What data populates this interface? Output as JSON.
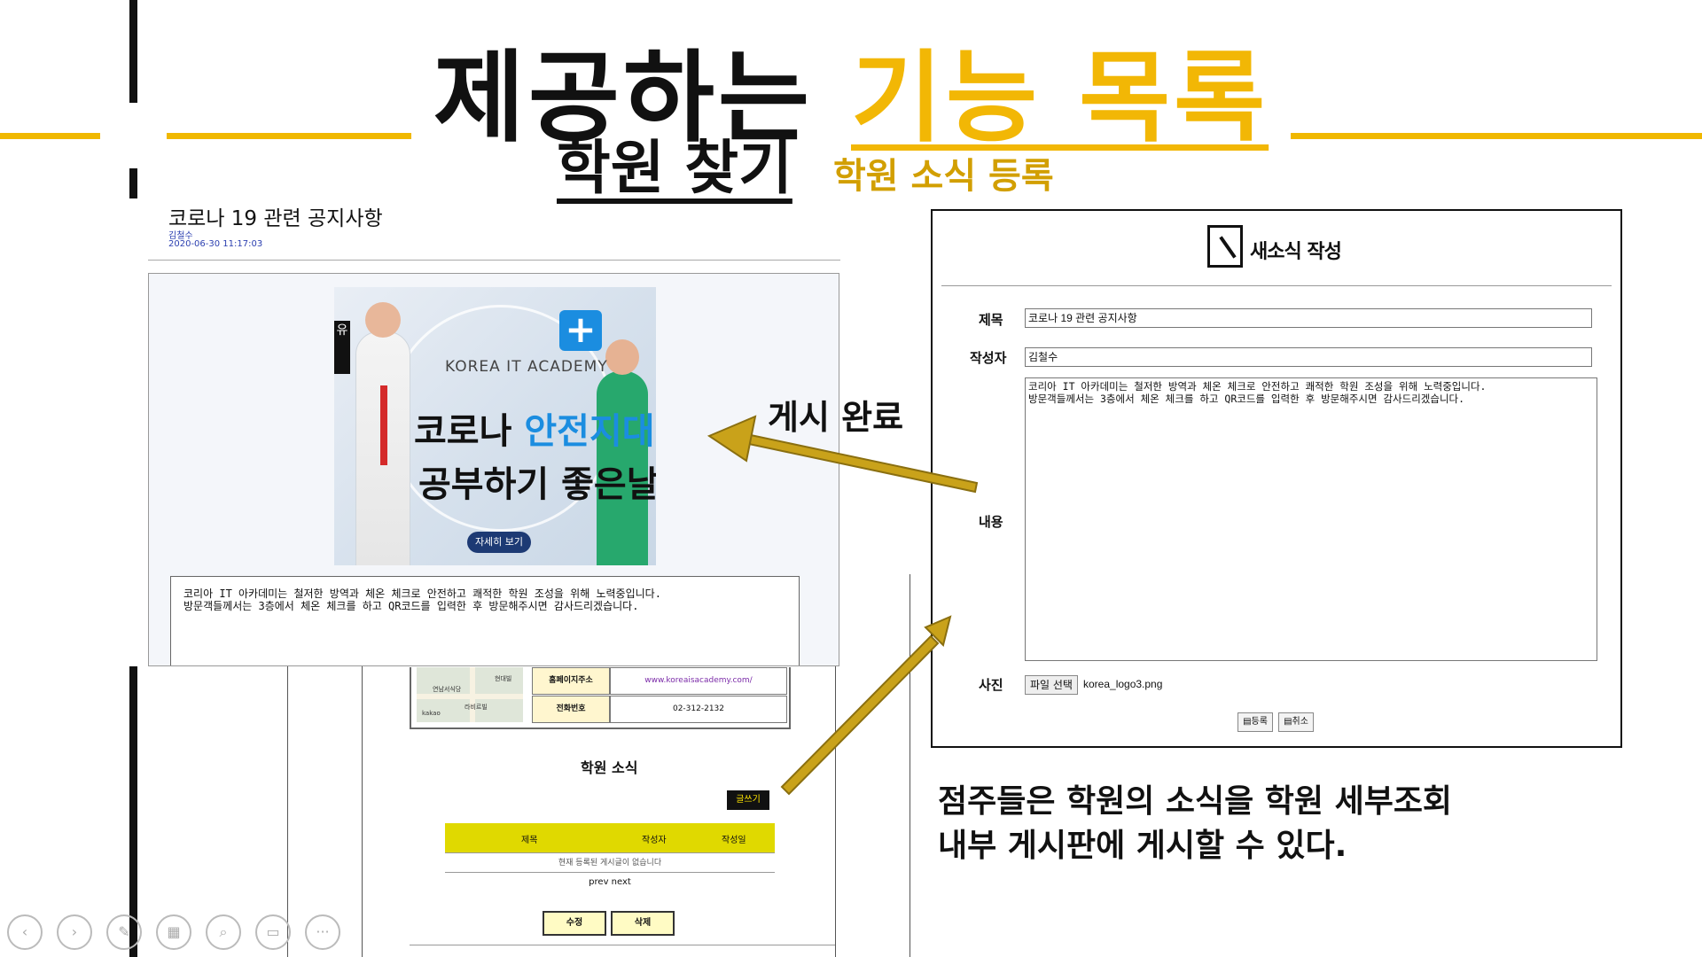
{
  "slide": {
    "title_main": "제공하는",
    "title_highlight": "기능 목록",
    "subtitle_main": "학원 찾기",
    "subtitle_secondary": "학원 소식 등록",
    "colors": {
      "accent": "#f2b705",
      "secondary_text": "#d29f00",
      "arrow": "#c9a21a"
    }
  },
  "post_view": {
    "title": "코로나 19 관련 공지사항",
    "author": "김철수",
    "date": "2020-06-30 11:17:03",
    "banner": {
      "academy": "KOREA IT ACADEMY",
      "line1_a": "코로나",
      "line1_b": "안전지대!",
      "line2": "공부하기 좋은날",
      "button": "자세히 보기"
    },
    "content_line1": "코리아 IT 아카데미는 철저한 방역과 체온 체크로 안전하고 쾌적한 학원 조성을 위해 노력중입니다.",
    "content_line2": "방문객들께서는 3층에서 체온 체크를 하고 QR코드를 입력한 후 방문해주시면 감사드리겠습니다."
  },
  "academy_detail": {
    "homepage_label": "홈페이지주소",
    "homepage_value": "www.koreaisacademy.com/",
    "phone_label": "전화번호",
    "phone_value": "02-312-2132",
    "map_brand": "kakao",
    "news_title": "학원 소식",
    "write_button": "글쓰기",
    "columns": [
      "제목",
      "작성자",
      "작성일"
    ],
    "empty_message": "현재 등록된 게시글이 없습니다",
    "pager": "prev next",
    "edit_button": "수정",
    "delete_button": "삭제"
  },
  "form": {
    "header": "새소식 작성",
    "title_label": "제목",
    "title_value": "코로나 19 관련 공지사항",
    "author_label": "작성자",
    "author_value": "김철수",
    "content_label": "내용",
    "content_line1": "코리아 IT 아카데미는 철저한 방역과 체온 체크로 안전하고 쾌적한 학원 조성을 위해 노력중입니다.",
    "content_line2": "방문객들께서는 3층에서 체온 체크를 하고 QR코드를 입력한 후 방문해주시면 감사드리겠습니다.",
    "photo_label": "사진",
    "file_button": "파일 선택",
    "file_name": "korea_logo3.png",
    "submit_button": "등록",
    "cancel_button": "취소"
  },
  "annotations": {
    "posted": "게시 완료",
    "description": "점주들은 학원의 소식을 학원 세부조회 내부 게시판에 게시할 수 있다."
  },
  "controls": {
    "icons": [
      "prev-icon",
      "next-icon",
      "pen-icon",
      "slides-icon",
      "zoom-icon",
      "subtitle-icon",
      "more-icon"
    ]
  }
}
